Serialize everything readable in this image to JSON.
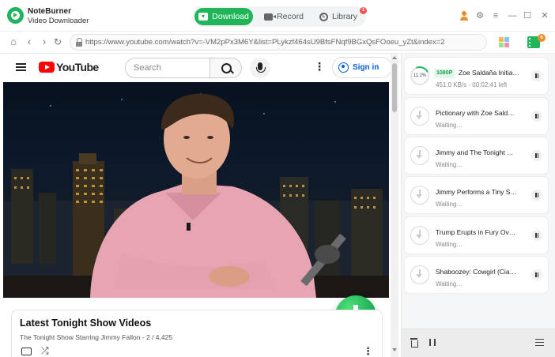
{
  "app": {
    "name": "NoteBurner",
    "subtitle": "Video Downloader"
  },
  "nav": {
    "tabs": [
      {
        "label": "Download",
        "active": true
      },
      {
        "label": "Record",
        "active": false
      },
      {
        "label": "Library",
        "active": false,
        "badge": "1"
      }
    ]
  },
  "toolbar": {
    "queue_badge": "6"
  },
  "address": {
    "url": "https://www.youtube.com/watch?v=-VM2pPx3M6Y&list=PLykzf464sU9BfsFNqf9BGxQsFOoeu_yZt&index=2"
  },
  "youtube": {
    "logo_text": "YouTube",
    "search_placeholder": "Search",
    "sign_in": "Sign in",
    "playlist": {
      "title": "Latest Tonight Show Videos",
      "subtitle": "The Tonight Show Starring Jimmy Fallon - 2 / 4,425"
    }
  },
  "queue": {
    "items": [
      {
        "progress": "11.2%",
        "quality": "1080P",
        "title": "Zoe Saldaña Initia…",
        "status": "451.0 KB/s - 00:02:41 left",
        "active": true
      },
      {
        "title": "Pictionary with Zoe Sald…",
        "status": "Waiting…",
        "active": false
      },
      {
        "title": "Jimmy and The Tonight …",
        "status": "Waiting…",
        "active": false
      },
      {
        "title": "Jimmy Performs a Tiny S…",
        "status": "Waiting…",
        "active": false
      },
      {
        "title": "Trump Erupts in Fury Ov…",
        "status": "Waiting…",
        "active": false
      },
      {
        "title": "Shaboozey: Cowgirl (Cia…",
        "status": "Waiting…",
        "active": false
      }
    ]
  },
  "colors": {
    "accent": "#20b559",
    "badge": "#f05656",
    "youtube_red": "#ff0000"
  }
}
